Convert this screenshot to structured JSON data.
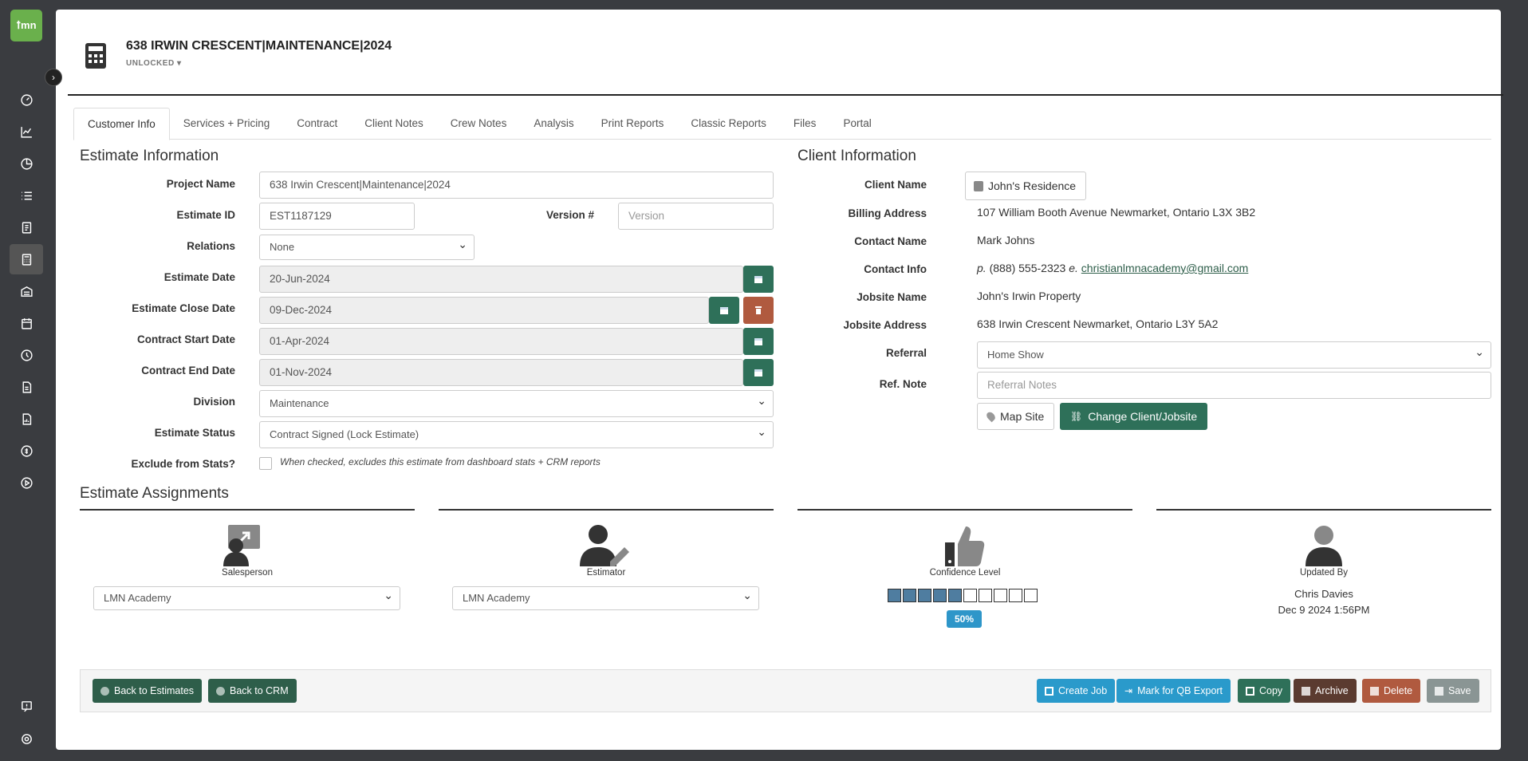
{
  "app": {
    "logo_text": "ꝉmn",
    "brand_color": "#6ab04c"
  },
  "sidebar": {
    "icons": [
      "dashboard-icon",
      "chart-line-icon",
      "pie-chart-icon",
      "list-icon",
      "document-icon",
      "calculator-icon",
      "warehouse-icon",
      "calendar-icon",
      "clock-icon",
      "invoice-icon",
      "file-chart-icon",
      "money-icon",
      "play-circle-icon",
      "help-icon",
      "settings-icon"
    ]
  },
  "header": {
    "title": "638 IRWIN CRESCENT|MAINTENANCE|2024",
    "lock_status": "UNLOCKED"
  },
  "tabs": [
    {
      "label": "Customer Info",
      "active": true
    },
    {
      "label": "Services + Pricing"
    },
    {
      "label": "Contract"
    },
    {
      "label": "Client Notes"
    },
    {
      "label": "Crew Notes"
    },
    {
      "label": "Analysis"
    },
    {
      "label": "Print Reports"
    },
    {
      "label": "Classic Reports"
    },
    {
      "label": "Files"
    },
    {
      "label": "Portal"
    }
  ],
  "estimate": {
    "heading": "Estimate Information",
    "project_name_label": "Project Name",
    "project_name": "638 Irwin Crescent|Maintenance|2024",
    "estimate_id_label": "Estimate ID",
    "estimate_id": "EST1187129",
    "version_label": "Version #",
    "version_placeholder": "Version",
    "relations_label": "Relations",
    "relations": "None",
    "estimate_date_label": "Estimate Date",
    "estimate_date": "20-Jun-2024",
    "close_date_label": "Estimate Close Date",
    "close_date": "09-Dec-2024",
    "contract_start_label": "Contract Start Date",
    "contract_start": "01-Apr-2024",
    "contract_end_label": "Contract End Date",
    "contract_end": "01-Nov-2024",
    "division_label": "Division",
    "division": "Maintenance",
    "status_label": "Estimate Status",
    "status": "Contract Signed (Lock Estimate)",
    "exclude_label": "Exclude from Stats?",
    "exclude_note": "When checked, excludes this estimate from dashboard stats + CRM reports"
  },
  "client": {
    "heading": "Client Information",
    "client_name_label": "Client Name",
    "client_name": "John's Residence",
    "billing_label": "Billing Address",
    "billing": "107 William Booth Avenue Newmarket, Ontario L3X 3B2",
    "contact_name_label": "Contact Name",
    "contact_name": "Mark Johns",
    "contact_info_label": "Contact Info",
    "phone_prefix": "p.",
    "phone": "(888) 555-2323",
    "email_prefix": "e.",
    "email": "christianlmnacademy@gmail.com",
    "jobsite_name_label": "Jobsite Name",
    "jobsite_name": "John's Irwin Property",
    "jobsite_address_label": "Jobsite Address",
    "jobsite_address": "638 Irwin Crescent Newmarket, Ontario L3Y 5A2",
    "referral_label": "Referral",
    "referral": "Home Show",
    "ref_note_label": "Ref. Note",
    "ref_note_placeholder": "Referral Notes",
    "map_site": "Map Site",
    "change_client": "Change Client/Jobsite"
  },
  "assignments": {
    "heading": "Estimate Assignments",
    "salesperson_label": "Salesperson",
    "salesperson": "LMN Academy",
    "estimator_label": "Estimator",
    "estimator": "LMN Academy",
    "confidence_label": "Confidence Level",
    "confidence_percent": 50,
    "confidence_text": "50%",
    "updated_by_label": "Updated By",
    "updated_by": "Chris Davies",
    "updated_at": "Dec 9 2024 1:56PM"
  },
  "footer": {
    "back_estimates": "Back to Estimates",
    "back_crm": "Back to CRM",
    "create_job": "Create Job",
    "mark_qb": "Mark for QB Export",
    "copy": "Copy",
    "archive": "Archive",
    "delete": "Delete",
    "save": "Save"
  }
}
